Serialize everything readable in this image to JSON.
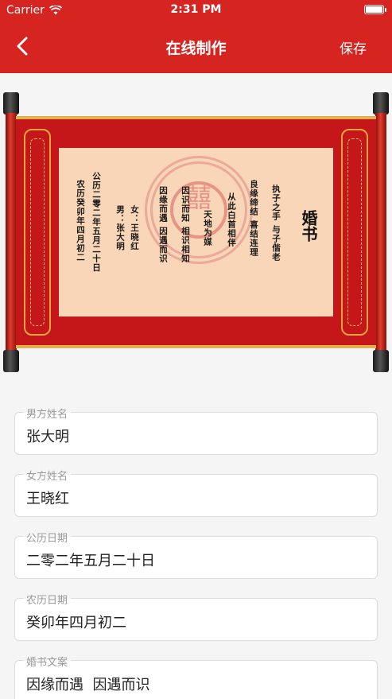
{
  "status": {
    "carrier": "Carrier",
    "time": "2:31 PM"
  },
  "nav": {
    "title": "在线制作",
    "save_label": "保存"
  },
  "certificate": {
    "title": "婚书",
    "col_1": "执子之手 与子偕老",
    "col_2": "良缘缔结 喜结连理",
    "col_3": "从此白首相伴",
    "col_4": "天地为媒",
    "col_5": "因识而知 相识相知",
    "col_6": "因缘而遇 因遇而识",
    "bride_line": "女：王晓红",
    "groom_line": "男：张大明",
    "solar_line": "公历二零二年五月二十日",
    "lunar_line": "农历癸卯年四月初二",
    "center_glyph": "囍"
  },
  "form": {
    "fields": [
      {
        "label": "男方姓名",
        "value": "张大明"
      },
      {
        "label": "女方姓名",
        "value": "王晓红"
      },
      {
        "label": "公历日期",
        "value": "二零二年五月二十日"
      },
      {
        "label": "农历日期",
        "value": "癸卯年四月初二"
      },
      {
        "label": "婚书文案",
        "value": "因缘而遇  因遇而识"
      }
    ]
  }
}
